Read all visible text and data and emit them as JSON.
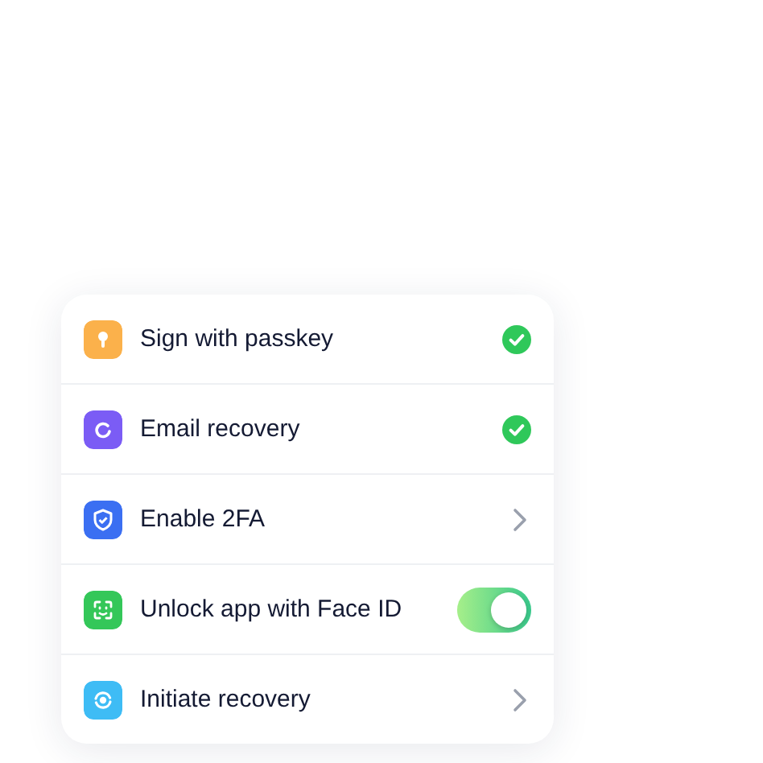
{
  "settings": [
    {
      "label": "Sign with passkey",
      "color": "#fbb14b",
      "kind": "check"
    },
    {
      "label": "Email recovery",
      "color": "#7b5cf5",
      "kind": "check"
    },
    {
      "label": "Enable 2FA",
      "color": "#3b6ff2",
      "kind": "link"
    },
    {
      "label": "Unlock app with Face ID",
      "color": "#34c759",
      "kind": "toggle",
      "on": true
    },
    {
      "label": "Initiate recovery",
      "color": "#3ebcf5",
      "kind": "link"
    }
  ]
}
